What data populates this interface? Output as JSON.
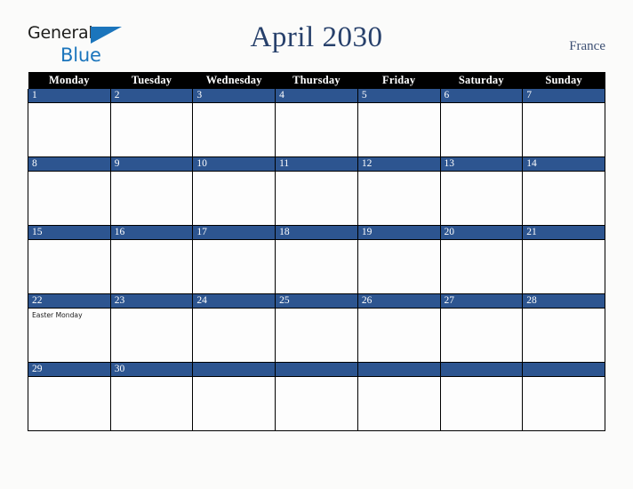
{
  "brand": {
    "name_part1": "General",
    "name_part2": "Blue",
    "triangle_color": "#1b75bc"
  },
  "header": {
    "title": "April 2030",
    "country": "France",
    "title_color": "#27406b"
  },
  "calendar": {
    "weekday_headers": [
      "Monday",
      "Tuesday",
      "Wednesday",
      "Thursday",
      "Friday",
      "Saturday",
      "Sunday"
    ],
    "header_bg": "#000000",
    "header_text_color": "#ffffff",
    "day_band_color": "#2d5590",
    "day_number_color": "#ffffff",
    "cell_bg": "#fdfdfd",
    "border_color": "#000000",
    "weeks": [
      {
        "days": [
          {
            "number": "1",
            "events": []
          },
          {
            "number": "2",
            "events": []
          },
          {
            "number": "3",
            "events": []
          },
          {
            "number": "4",
            "events": []
          },
          {
            "number": "5",
            "events": []
          },
          {
            "number": "6",
            "events": []
          },
          {
            "number": "7",
            "events": []
          }
        ]
      },
      {
        "days": [
          {
            "number": "8",
            "events": []
          },
          {
            "number": "9",
            "events": []
          },
          {
            "number": "10",
            "events": []
          },
          {
            "number": "11",
            "events": []
          },
          {
            "number": "12",
            "events": []
          },
          {
            "number": "13",
            "events": []
          },
          {
            "number": "14",
            "events": []
          }
        ]
      },
      {
        "days": [
          {
            "number": "15",
            "events": []
          },
          {
            "number": "16",
            "events": []
          },
          {
            "number": "17",
            "events": []
          },
          {
            "number": "18",
            "events": []
          },
          {
            "number": "19",
            "events": []
          },
          {
            "number": "20",
            "events": []
          },
          {
            "number": "21",
            "events": []
          }
        ]
      },
      {
        "days": [
          {
            "number": "22",
            "events": [
              "Easter Monday"
            ]
          },
          {
            "number": "23",
            "events": []
          },
          {
            "number": "24",
            "events": []
          },
          {
            "number": "25",
            "events": []
          },
          {
            "number": "26",
            "events": []
          },
          {
            "number": "27",
            "events": []
          },
          {
            "number": "28",
            "events": []
          }
        ]
      },
      {
        "days": [
          {
            "number": "29",
            "events": []
          },
          {
            "number": "30",
            "events": []
          },
          {
            "number": "",
            "events": []
          },
          {
            "number": "",
            "events": []
          },
          {
            "number": "",
            "events": []
          },
          {
            "number": "",
            "events": []
          },
          {
            "number": "",
            "events": []
          }
        ]
      }
    ]
  }
}
